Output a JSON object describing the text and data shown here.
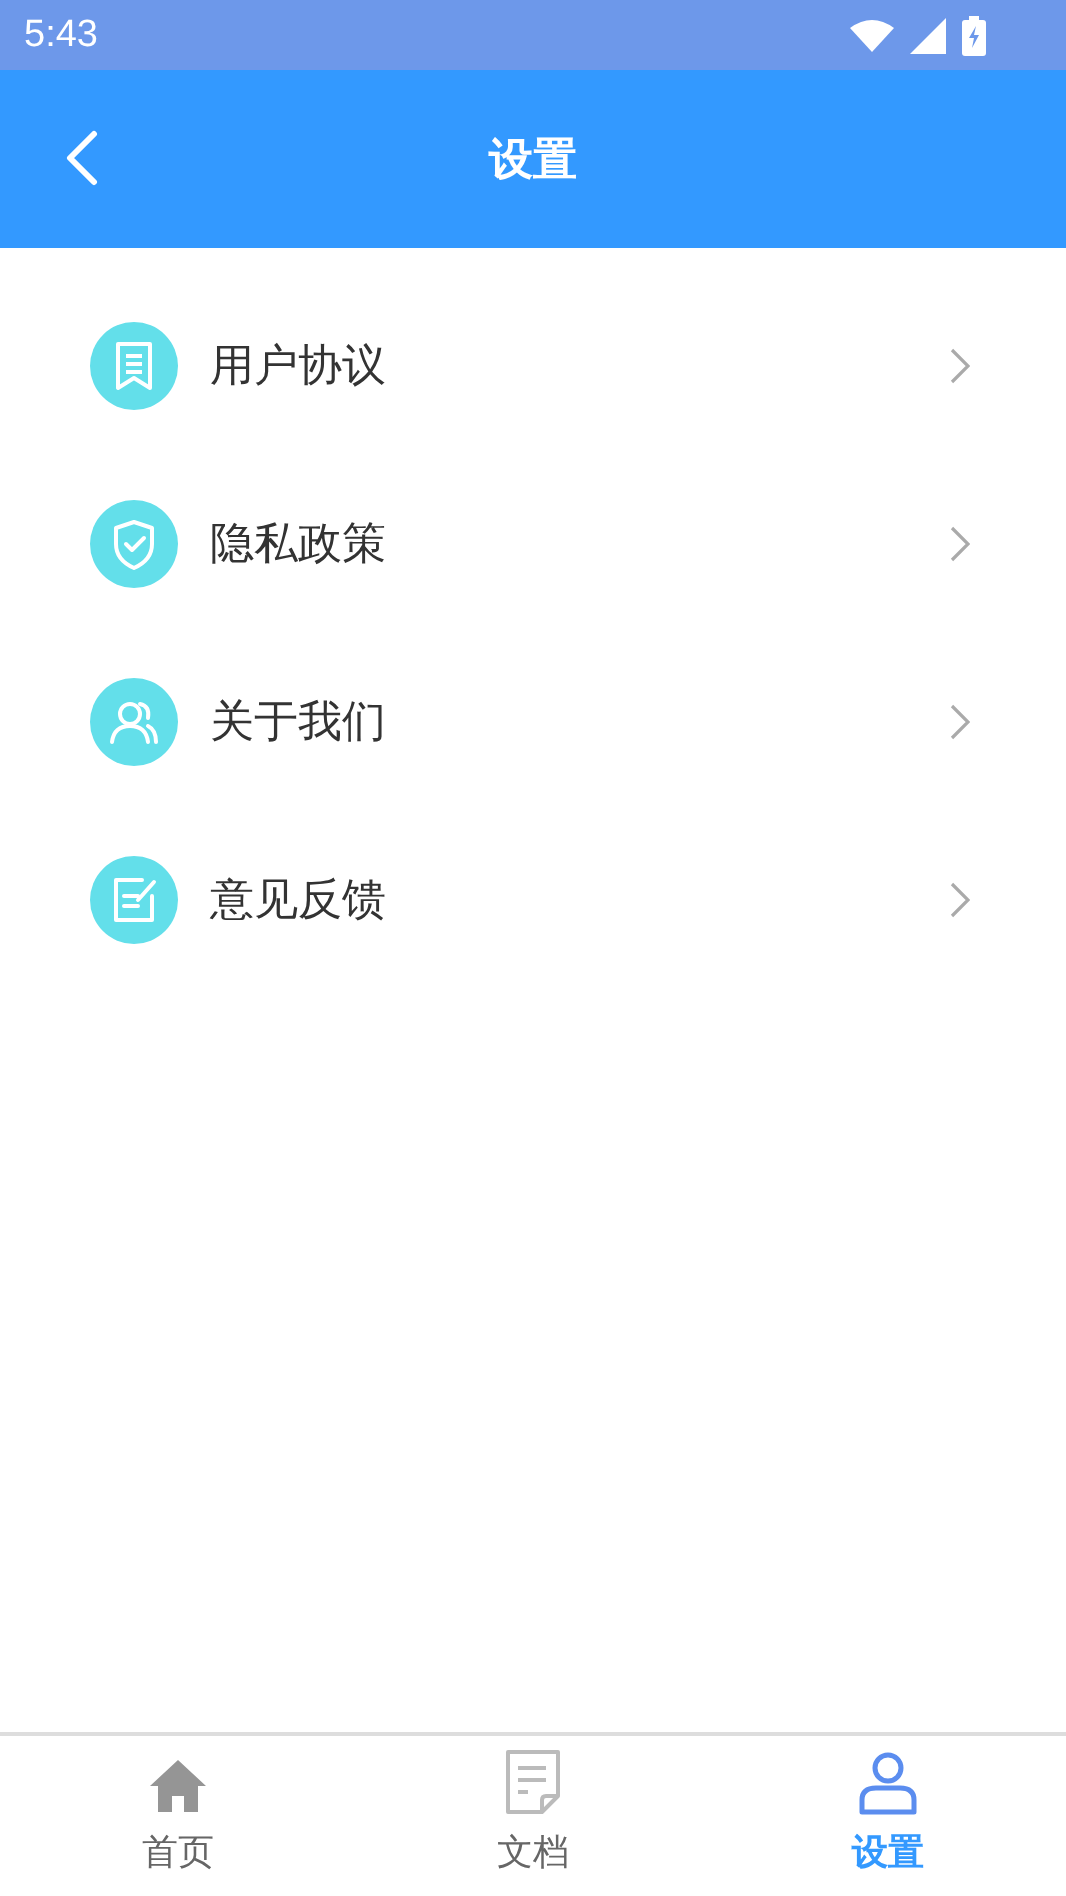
{
  "status_bar": {
    "time": "5:43"
  },
  "header": {
    "title": "设置"
  },
  "menu": [
    {
      "kind": "document",
      "label": "用户协议"
    },
    {
      "kind": "shield",
      "label": "隐私政策"
    },
    {
      "kind": "people",
      "label": "关于我们"
    },
    {
      "kind": "edit",
      "label": "意见反馈"
    }
  ],
  "tabs": [
    {
      "kind": "home",
      "label": "首页",
      "selected": false
    },
    {
      "kind": "doc",
      "label": "文档",
      "selected": false
    },
    {
      "kind": "user",
      "label": "设置",
      "selected": true
    }
  ]
}
